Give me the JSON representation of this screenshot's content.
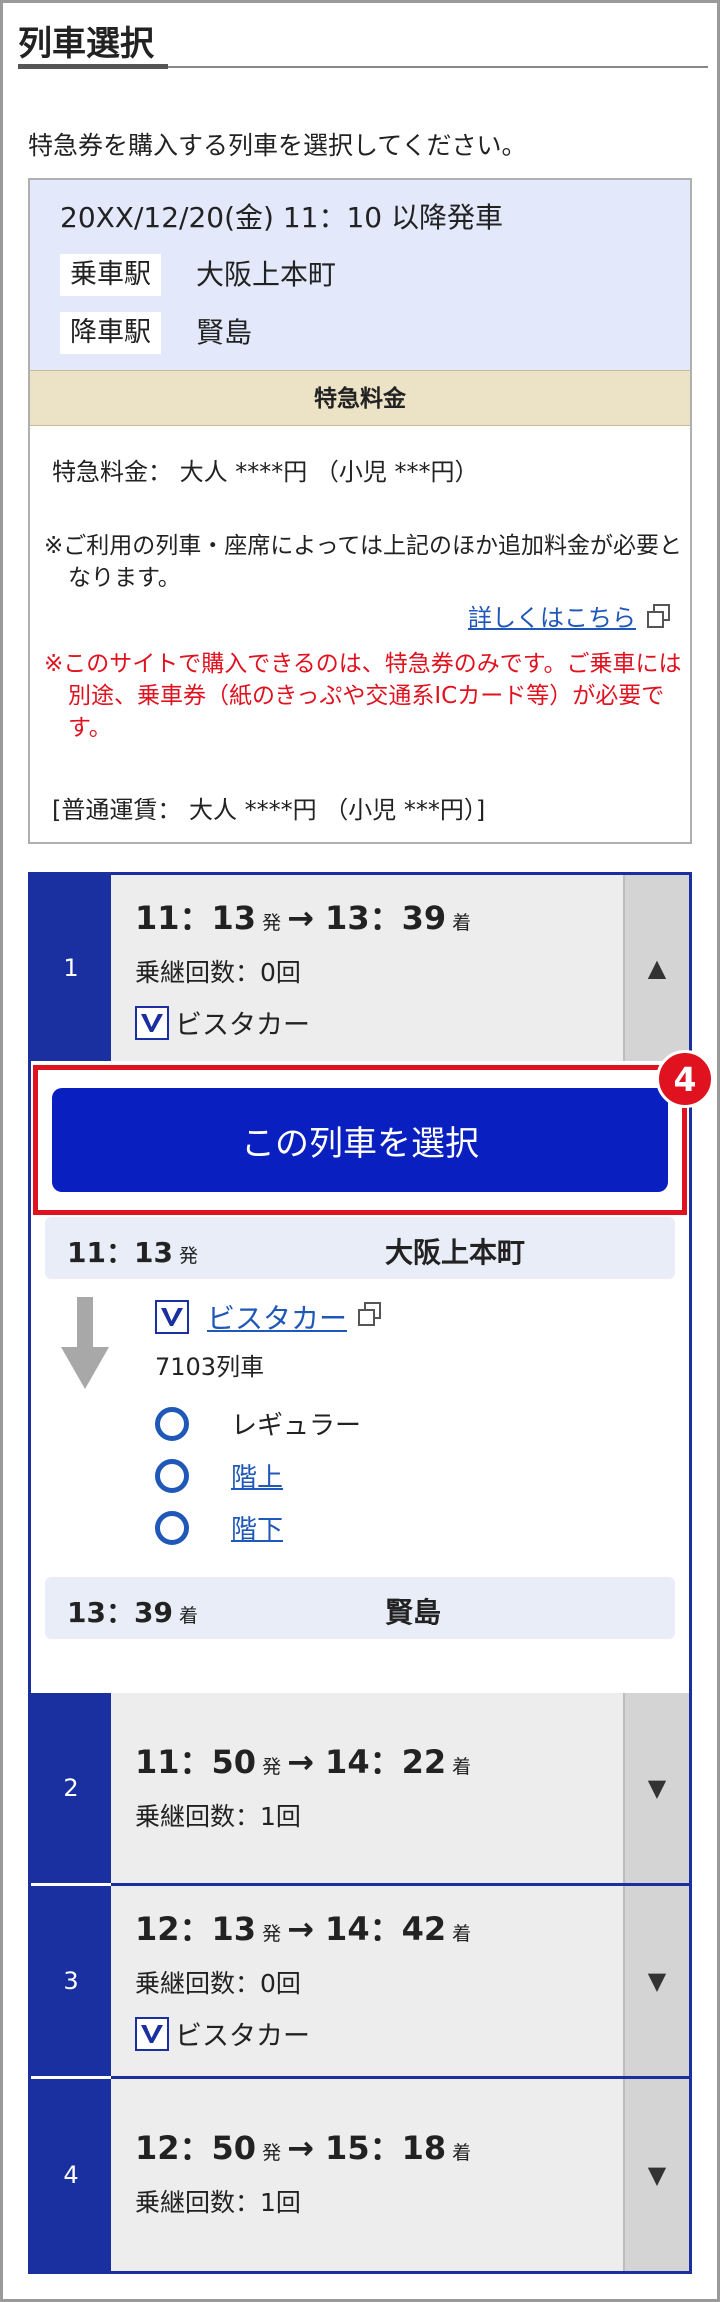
{
  "page": {
    "title": "列車選択",
    "instruction": "特急券を購入する列車を選択してください。"
  },
  "route": {
    "datetime": "20XX/12/20(金) 11：10 以降発車",
    "boarding_label": "乗車駅",
    "boarding_station": "大阪上本町",
    "alighting_label": "降車駅",
    "alighting_station": "賢島"
  },
  "fee": {
    "header": "特急料金",
    "line": "特急料金：  大人 ****円 （小児 ***円）",
    "note1": "※ご利用の列車・座席によっては上記のほか追加料金が必要となります。",
    "detail_link": "詳しくはこちら",
    "note2": "※このサイトで購入できるのは、特急券のみです。ご乗車には別途、乗車券（紙のきっぷや交通系ICカード等）が必要です。",
    "regular_fare": "[普通運賃：  大人 ****円 （小児 ***円）]"
  },
  "trains": [
    {
      "num": "1",
      "dep": "11：13",
      "arr": "13：39",
      "dep_suffix": "発",
      "arr_suffix": "着",
      "arrow": "→",
      "transfers": "乗継回数：0回",
      "train_name": "ビスタカー",
      "toggle": "▲"
    },
    {
      "num": "2",
      "dep": "11：50",
      "arr": "14：22",
      "dep_suffix": "発",
      "arr_suffix": "着",
      "arrow": "→",
      "transfers": "乗継回数：1回",
      "toggle": "▼"
    },
    {
      "num": "3",
      "dep": "12：13",
      "arr": "14：42",
      "dep_suffix": "発",
      "arr_suffix": "着",
      "arrow": "→",
      "transfers": "乗継回数：0回",
      "train_name": "ビスタカー",
      "toggle": "▼"
    },
    {
      "num": "4",
      "dep": "12：50",
      "arr": "15：18",
      "dep_suffix": "発",
      "arr_suffix": "着",
      "arrow": "→",
      "transfers": "乗継回数：1回",
      "toggle": "▼"
    }
  ],
  "selection": {
    "button_label": "この列車を選択",
    "step_badge": "4",
    "from_time": "11：13",
    "from_suffix": "発",
    "from_station": "大阪上本町",
    "train_name": "ビスタカー",
    "train_number": "7103列車",
    "seat_options": [
      "レギュラー",
      "階上",
      "階下"
    ],
    "to_time": "13：39",
    "to_suffix": "着",
    "to_station": "賢島"
  },
  "colors": {
    "accent_blue": "#1a2fa0",
    "button_blue": "#0a1fbf",
    "alert_red": "#e0121f",
    "link_blue": "#1f58b8"
  }
}
